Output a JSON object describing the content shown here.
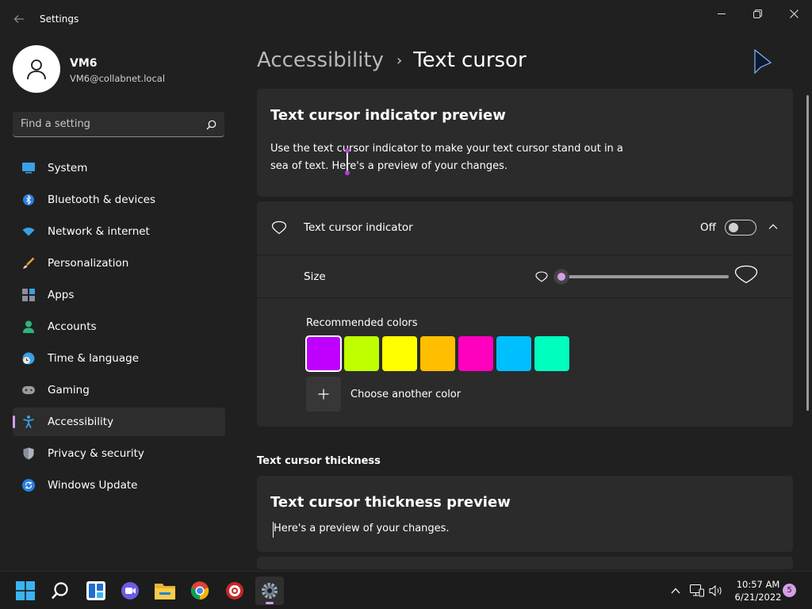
{
  "window": {
    "title": "Settings"
  },
  "profile": {
    "name": "VM6",
    "email": "VM6@collabnet.local"
  },
  "search": {
    "placeholder": "Find a setting"
  },
  "sidebar": {
    "items": [
      {
        "label": "System",
        "icon": "monitor-icon",
        "active": false
      },
      {
        "label": "Bluetooth & devices",
        "icon": "bluetooth-icon",
        "active": false
      },
      {
        "label": "Network & internet",
        "icon": "wifi-icon",
        "active": false
      },
      {
        "label": "Personalization",
        "icon": "brush-icon",
        "active": false
      },
      {
        "label": "Apps",
        "icon": "apps-icon",
        "active": false
      },
      {
        "label": "Accounts",
        "icon": "person-icon",
        "active": false
      },
      {
        "label": "Time & language",
        "icon": "globe-clock-icon",
        "active": false
      },
      {
        "label": "Gaming",
        "icon": "gamepad-icon",
        "active": false
      },
      {
        "label": "Accessibility",
        "icon": "accessibility-icon",
        "active": true
      },
      {
        "label": "Privacy & security",
        "icon": "shield-icon",
        "active": false
      },
      {
        "label": "Windows Update",
        "icon": "update-icon",
        "active": false
      }
    ]
  },
  "breadcrumb": {
    "parent": "Accessibility",
    "separator": "›",
    "current": "Text cursor"
  },
  "preview_card": {
    "title": "Text cursor indicator preview",
    "text": "Use the text cursor indicator to make your text cursor stand out in a sea of text. Here's a preview of your changes."
  },
  "indicator": {
    "label": "Text cursor indicator",
    "state": "Off",
    "enabled": false,
    "size_label": "Size",
    "size_value": 0,
    "colors_label": "Recommended colors",
    "colors": [
      "#bf00ff",
      "#bfff00",
      "#ffff00",
      "#ffbf00",
      "#ff00bf",
      "#00bfff",
      "#00ffbf"
    ],
    "selected_color_index": 0,
    "add_color_label": "Choose another color"
  },
  "thickness": {
    "section_heading": "Text cursor thickness",
    "title": "Text cursor thickness preview",
    "text": "Here's a preview of your changes."
  },
  "taskbar": {
    "time": "10:57 AM",
    "date": "6/21/2022",
    "notification_count": "5",
    "apps": [
      "start-icon",
      "search-icon",
      "widgets-icon",
      "teams-chat-icon",
      "file-explorer-icon",
      "chrome-icon",
      "app-icon",
      "settings-icon"
    ],
    "accent": "#d79ee8"
  }
}
